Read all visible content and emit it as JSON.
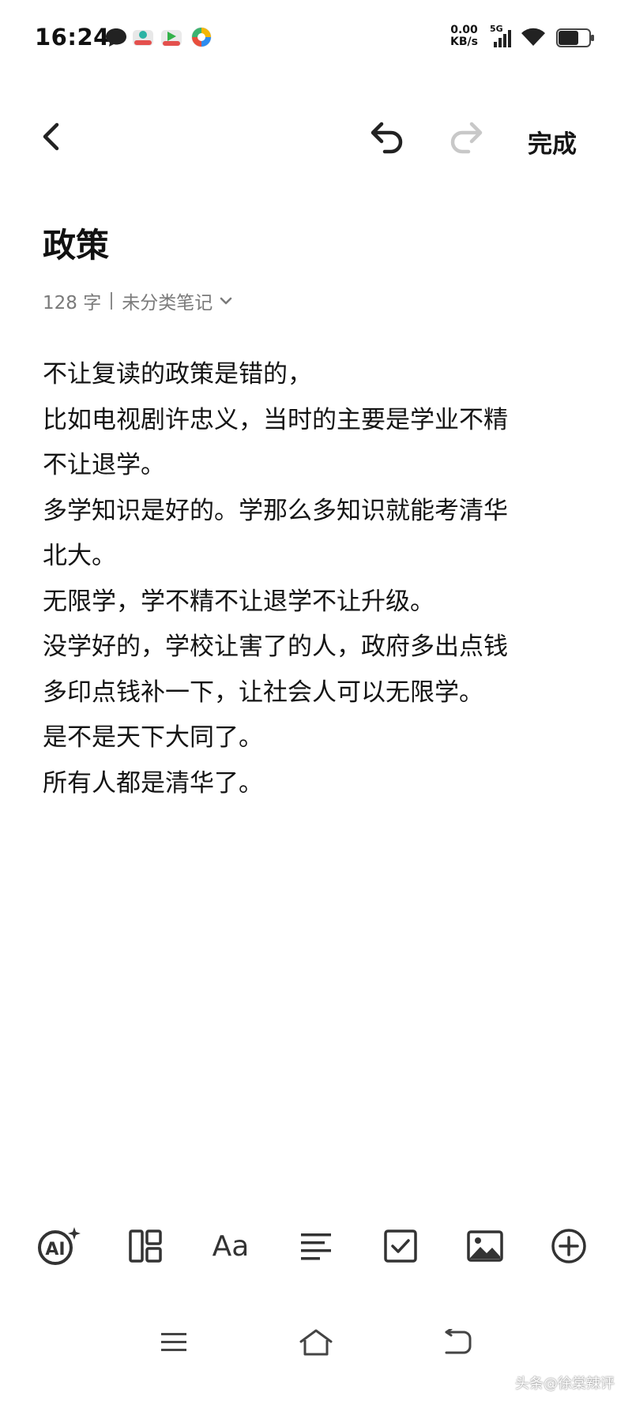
{
  "status_bar": {
    "time": "16:24",
    "net_speed_value": "0.00",
    "net_speed_unit": "KB/s",
    "network": "5G",
    "icons": [
      "message-icon",
      "app-icon-1",
      "app-icon-2",
      "app-icon-3",
      "signal-icon",
      "wifi-icon",
      "battery-icon"
    ]
  },
  "toolbar": {
    "back_icon": "chevron-left-icon",
    "undo_icon": "undo-icon",
    "redo_icon": "redo-icon",
    "done_label": "完成"
  },
  "note": {
    "title": "政策",
    "word_count": "128 字",
    "category": "未分类笔记",
    "lines": [
      "不让复读的政策是错的，",
      "比如电视剧许忠义，当时的主要是学业不精",
      "不让退学。",
      "多学知识是好的。学那么多知识就能考清华",
      "北大。",
      "无限学，学不精不让退学不让升级。",
      "没学好的，学校让害了的人，政府多出点钱",
      "多印点钱补一下，让社会人可以无限学。",
      "是不是天下大同了。",
      "所有人都是清华了。"
    ]
  },
  "format_bar": {
    "items": [
      "ai-icon",
      "layout-icon",
      "text-format-icon",
      "align-icon",
      "checklist-icon",
      "image-icon",
      "add-icon"
    ],
    "ai_label": "AI",
    "text_format_label": "Aa"
  },
  "nav_bar": {
    "items": [
      "menu-icon",
      "home-icon",
      "back-icon"
    ]
  },
  "watermark": "头条@徐棠辣评",
  "colors": {
    "text": "#111111",
    "meta": "#7a7a7a",
    "redo_disabled": "#c8c8c8",
    "icon": "#3a3a3a"
  }
}
